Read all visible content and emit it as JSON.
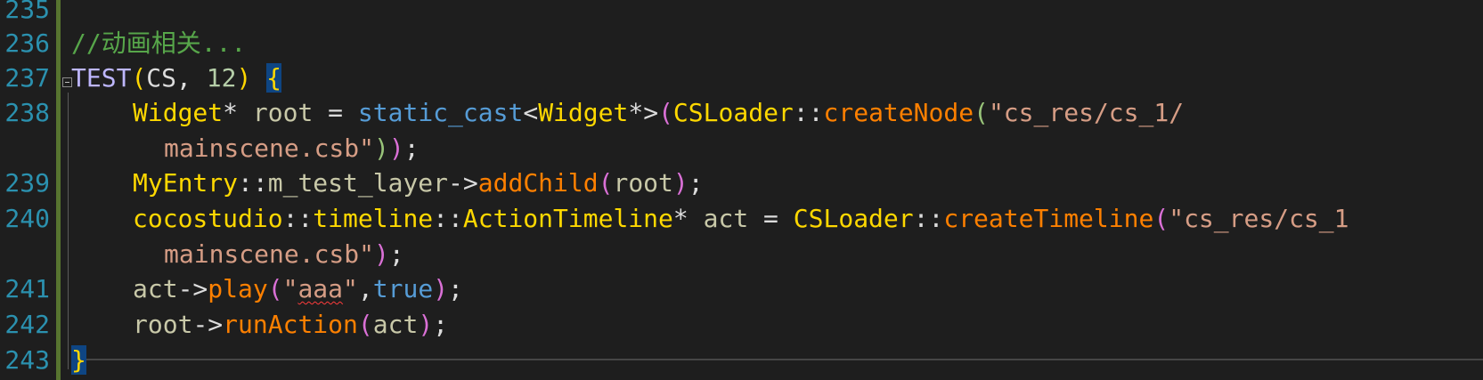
{
  "editor": {
    "language": "C++",
    "line_numbers": [
      "235",
      "236",
      "237",
      "238",
      "239",
      "240",
      "241",
      "242",
      "243"
    ],
    "code": {
      "line236_comment": "//动画相关...",
      "line237": {
        "macro": "TEST",
        "open_paren": "(",
        "arg1": "CS",
        "comma": ", ",
        "arg2": "12",
        "close_paren": ")",
        "brace": "{"
      },
      "line238": {
        "type": "Widget",
        "ptr_star": "* ",
        "var": "root",
        "assign": " = ",
        "cast_kw": "static_cast",
        "lt": "<",
        "cast_type": "Widget",
        "cast_tail": "*>",
        "open_paren": "(",
        "class": "CSLoader",
        "scope": "::",
        "func": "createNode",
        "open_paren2": "(",
        "string_part1": "\"cs_res/cs_1/",
        "string_part2": "mainscene.csb\"",
        "close_paren2": ")",
        "close_paren": ")",
        "semicolon": ";"
      },
      "line239": {
        "class": "MyEntry",
        "scope": "::",
        "member": "m_test_layer",
        "arrow": "->",
        "func": "addChild",
        "open_paren": "(",
        "arg": "root",
        "close_paren": ")",
        "semicolon": ";"
      },
      "line240": {
        "ns1": "cocostudio",
        "scope1": "::",
        "ns2": "timeline",
        "scope2": "::",
        "type": "ActionTimeline",
        "ptr_star": "* ",
        "var": "act",
        "assign": " = ",
        "class": "CSLoader",
        "scope3": "::",
        "func": "createTimeline",
        "open_paren": "(",
        "string_part1": "\"cs_res/cs_1",
        "string_part2": "mainscene.csb\"",
        "close_paren": ")",
        "semicolon": ";"
      },
      "line241": {
        "var": "act",
        "arrow": "->",
        "func": "play",
        "open_paren": "(",
        "quote_open": "\"",
        "string_inner": "aaa",
        "quote_close": "\"",
        "comma": ",",
        "bool": "true",
        "close_paren": ")",
        "semicolon": ";"
      },
      "line242": {
        "var": "root",
        "arrow": "->",
        "func": "runAction",
        "open_paren": "(",
        "arg": "act",
        "close_paren": ")",
        "semicolon": ";"
      },
      "line243_brace": "}"
    },
    "colors": {
      "background": "#1e1e1e",
      "line_number": "#2b91af",
      "comment": "#57a64a",
      "type": "#ffd800",
      "keyword": "#569cd6",
      "function": "#ff8000",
      "string": "#d69d85",
      "change_bar": "#577430",
      "brace_highlight": "#0e4583"
    }
  }
}
